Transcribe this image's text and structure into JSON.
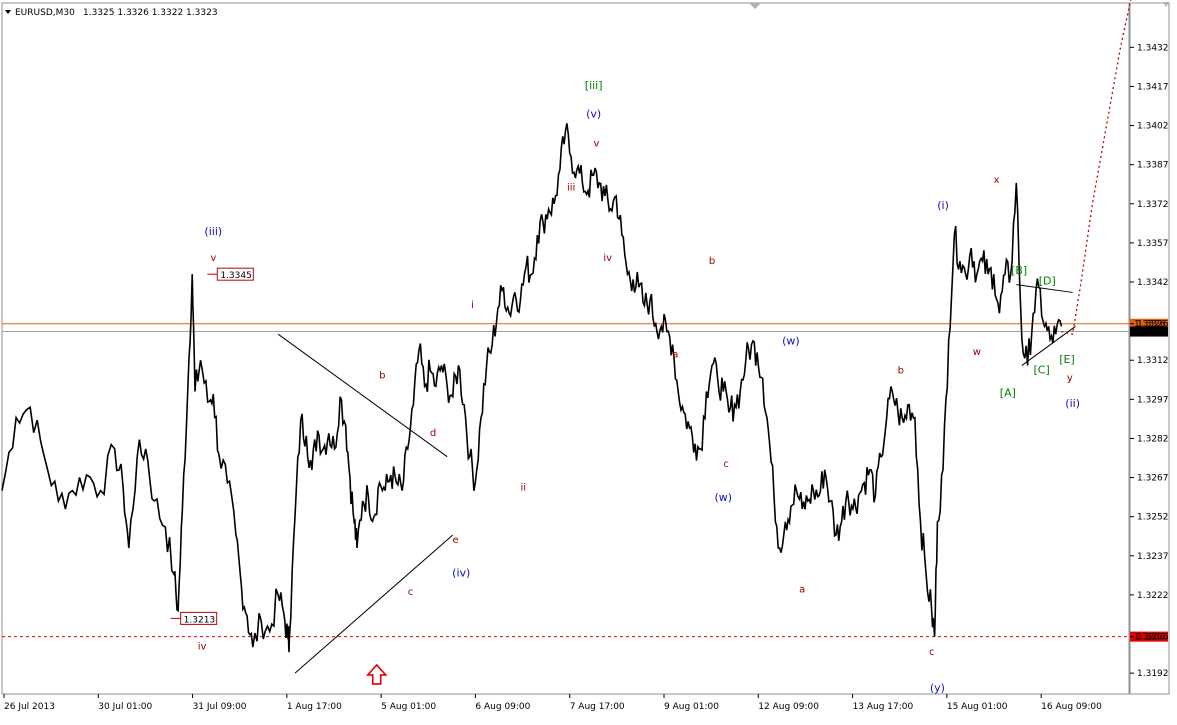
{
  "chart_data": {
    "type": "line",
    "symbol": "EURUSD,M30",
    "header_values": "1.3325 1.3326 1.3322 1.3323",
    "ylim": [
      1.3184,
      1.3449
    ],
    "yticks": [
      "1.3432",
      "1.3417",
      "1.3402",
      "1.3387",
      "1.3372",
      "1.3357",
      "1.3342",
      "1.3326",
      "1.3312",
      "1.3297",
      "1.3282",
      "1.3267",
      "1.3252",
      "1.3237",
      "1.3222",
      "1.3206",
      "1.3192"
    ],
    "current_price": "1.3323",
    "horizontal_lines": [
      {
        "value": 1.3326,
        "label": "1.3326",
        "color": "#e06010",
        "style": "solid"
      },
      {
        "value": 1.3323,
        "label": "1.3323",
        "color": "#a0a0a0",
        "style": "solid"
      },
      {
        "value": 1.3206,
        "label": "1.3206",
        "color": "#e00000",
        "style": "dotted"
      }
    ],
    "x_labels": [
      "26 Jul 2013",
      "30 Jul 01:00",
      "31 Jul 09:00",
      "1 Aug 17:00",
      "5 Aug 01:00",
      "6 Aug 09:00",
      "7 Aug 17:00",
      "9 Aug 01:00",
      "12 Aug 09:00",
      "13 Aug 17:00",
      "15 Aug 01:00",
      "16 Aug 09:00"
    ],
    "price_series": [
      [
        0,
        1.3262
      ],
      [
        0.5,
        1.329
      ],
      [
        1,
        1.3294
      ],
      [
        1.5,
        1.3275
      ],
      [
        2,
        1.3258
      ],
      [
        2.5,
        1.3262
      ],
      [
        3,
        1.3268
      ],
      [
        3.5,
        1.3262
      ],
      [
        4,
        1.3278
      ],
      [
        4.3,
        1.3263
      ],
      [
        4.5,
        1.324
      ],
      [
        4.8,
        1.3275
      ],
      [
        5.1,
        1.3278
      ],
      [
        5.4,
        1.3258
      ],
      [
        5.8,
        1.3248
      ],
      [
        6.1,
        1.323
      ],
      [
        6.25,
        1.3216
      ],
      [
        6.4,
        1.3254
      ],
      [
        6.6,
        1.3303
      ],
      [
        6.75,
        1.3345
      ],
      [
        6.85,
        1.33
      ],
      [
        7.05,
        1.3312
      ],
      [
        7.3,
        1.3296
      ],
      [
        7.5,
        1.3299
      ],
      [
        7.7,
        1.3276
      ],
      [
        8,
        1.3265
      ],
      [
        8.3,
        1.3245
      ],
      [
        8.5,
        1.3225
      ],
      [
        8.7,
        1.3214
      ],
      [
        8.9,
        1.3202
      ],
      [
        9.2,
        1.3212
      ],
      [
        9.5,
        1.3208
      ],
      [
        9.8,
        1.3222
      ],
      [
        10,
        1.3215
      ],
      [
        10.15,
        1.3205
      ],
      [
        10.2,
        1.3206
      ],
      [
        10.4,
        1.3252
      ],
      [
        10.6,
        1.3289
      ],
      [
        10.8,
        1.3283
      ],
      [
        11,
        1.327
      ],
      [
        11.2,
        1.3285
      ],
      [
        11.4,
        1.3278
      ],
      [
        11.6,
        1.3284
      ],
      [
        11.8,
        1.3278
      ],
      [
        12,
        1.3298
      ],
      [
        12.2,
        1.3287
      ],
      [
        12.35,
        1.3267
      ],
      [
        12.5,
        1.325
      ],
      [
        12.6,
        1.324
      ],
      [
        12.8,
        1.3258
      ],
      [
        13,
        1.326
      ],
      [
        13.2,
        1.3252
      ],
      [
        13.4,
        1.3265
      ],
      [
        13.6,
        1.3262
      ],
      [
        13.8,
        1.3268
      ],
      [
        14,
        1.3265
      ],
      [
        14.2,
        1.3262
      ],
      [
        14.4,
        1.3278
      ],
      [
        14.6,
        1.3295
      ],
      [
        14.8,
        1.3316
      ],
      [
        15,
        1.3302
      ],
      [
        15.2,
        1.3308
      ],
      [
        15.4,
        1.3302
      ],
      [
        15.6,
        1.331
      ],
      [
        15.8,
        1.3302
      ],
      [
        16,
        1.3298
      ],
      [
        16.2,
        1.331
      ],
      [
        16.4,
        1.3295
      ],
      [
        16.6,
        1.3275
      ],
      [
        16.8,
        1.3265
      ],
      [
        17,
        1.329
      ],
      [
        17.2,
        1.331
      ],
      [
        17.4,
        1.3318
      ],
      [
        17.6,
        1.3332
      ],
      [
        17.8,
        1.334
      ],
      [
        18,
        1.333
      ],
      [
        18.2,
        1.3338
      ],
      [
        18.4,
        1.3335
      ],
      [
        18.6,
        1.3348
      ],
      [
        18.8,
        1.3345
      ],
      [
        19,
        1.336
      ],
      [
        19.2,
        1.3365
      ],
      [
        19.4,
        1.337
      ],
      [
        19.6,
        1.3372
      ],
      [
        19.8,
        1.3385
      ],
      [
        20,
        1.34
      ],
      [
        20.2,
        1.339
      ],
      [
        20.4,
        1.3385
      ],
      [
        20.6,
        1.338
      ],
      [
        20.8,
        1.3377
      ],
      [
        21,
        1.3383
      ],
      [
        21.2,
        1.338
      ],
      [
        21.4,
        1.3375
      ],
      [
        21.6,
        1.337
      ],
      [
        21.8,
        1.3375
      ],
      [
        22,
        1.336
      ],
      [
        22.2,
        1.3345
      ],
      [
        22.4,
        1.3343
      ],
      [
        22.6,
        1.334
      ],
      [
        22.8,
        1.3333
      ],
      [
        23,
        1.3335
      ],
      [
        23.2,
        1.3326
      ],
      [
        23.4,
        1.3325
      ],
      [
        23.6,
        1.3323
      ],
      [
        23.8,
        1.3318
      ],
      [
        24,
        1.33
      ],
      [
        24.2,
        1.3292
      ],
      [
        24.4,
        1.3286
      ],
      [
        24.6,
        1.328
      ],
      [
        24.8,
        1.3278
      ],
      [
        25,
        1.33
      ],
      [
        25.2,
        1.331
      ],
      [
        25.4,
        1.3305
      ],
      [
        25.6,
        1.33
      ],
      [
        25.8,
        1.3292
      ],
      [
        26,
        1.3295
      ],
      [
        26.2,
        1.33
      ],
      [
        26.4,
        1.3312
      ],
      [
        26.6,
        1.3318
      ],
      [
        26.8,
        1.3315
      ],
      [
        27,
        1.3305
      ],
      [
        27.2,
        1.3285
      ],
      [
        27.4,
        1.326
      ],
      [
        27.6,
        1.324
      ],
      [
        27.8,
        1.325
      ],
      [
        28,
        1.3256
      ],
      [
        28.2,
        1.3262
      ],
      [
        28.4,
        1.3255
      ],
      [
        28.6,
        1.3258
      ],
      [
        28.8,
        1.3262
      ],
      [
        29,
        1.326
      ],
      [
        29.2,
        1.327
      ],
      [
        29.4,
        1.3258
      ],
      [
        29.6,
        1.3245
      ],
      [
        29.8,
        1.325
      ],
      [
        30,
        1.3262
      ],
      [
        30.2,
        1.3255
      ],
      [
        30.4,
        1.326
      ],
      [
        30.6,
        1.3265
      ],
      [
        30.8,
        1.327
      ],
      [
        31,
        1.326
      ],
      [
        31.2,
        1.3275
      ],
      [
        31.4,
        1.329
      ],
      [
        31.6,
        1.33
      ],
      [
        31.8,
        1.3292
      ],
      [
        32,
        1.3288
      ],
      [
        32.2,
        1.3295
      ],
      [
        32.4,
        1.329
      ],
      [
        32.6,
        1.325
      ],
      [
        32.8,
        1.323
      ],
      [
        33,
        1.3215
      ],
      [
        33.1,
        1.3206
      ],
      [
        33.2,
        1.325
      ],
      [
        33.4,
        1.327
      ],
      [
        33.6,
        1.332
      ],
      [
        33.8,
        1.336
      ],
      [
        34,
        1.335
      ],
      [
        34.2,
        1.3345
      ],
      [
        34.4,
        1.3355
      ],
      [
        34.6,
        1.3345
      ],
      [
        34.8,
        1.335
      ],
      [
        35,
        1.3345
      ],
      [
        35.2,
        1.3345
      ],
      [
        35.4,
        1.333
      ],
      [
        35.6,
        1.3345
      ],
      [
        35.8,
        1.3345
      ],
      [
        36,
        1.338
      ],
      [
        36.2,
        1.332
      ],
      [
        36.4,
        1.331
      ],
      [
        36.6,
        1.333
      ],
      [
        36.8,
        1.334
      ],
      [
        37,
        1.3325
      ],
      [
        37.2,
        1.332
      ],
      [
        37.4,
        1.3322
      ],
      [
        37.6,
        1.3325
      ]
    ],
    "projection": [
      [
        37.6,
        1.3323
      ],
      [
        38.0,
        1.3322
      ],
      [
        38.3,
        1.3342
      ],
      [
        38.7,
        1.3372
      ],
      [
        39.2,
        1.3402
      ],
      [
        39.7,
        1.3432
      ],
      [
        40.1,
        1.3452
      ]
    ],
    "triangle_lines": [
      {
        "from": [
          9.8,
          1.3322
        ],
        "to": [
          15.8,
          1.3275
        ]
      },
      {
        "from": [
          10.4,
          1.3192
        ],
        "to": [
          16.0,
          1.3245
        ]
      },
      {
        "from": [
          36.0,
          1.3341
        ],
        "to": [
          38.0,
          1.3338
        ]
      },
      {
        "from": [
          36.2,
          1.331
        ],
        "to": [
          38.1,
          1.3325
        ]
      }
    ],
    "price_tags": [
      {
        "text": "1.3345",
        "x": 7.5,
        "y": 1.3345
      },
      {
        "text": "1.3213",
        "x": 6.2,
        "y": 1.3213
      }
    ],
    "wave_labels": [
      {
        "text": "[iii]",
        "x": 21.0,
        "y": 1.3416,
        "color": "#008000"
      },
      {
        "text": "(v)",
        "x": 21.0,
        "y": 1.3405,
        "color": "#1010c0"
      },
      {
        "text": "v",
        "x": 21.1,
        "y": 1.3394,
        "color": "#a00000"
      },
      {
        "text": "iii",
        "x": 20.2,
        "y": 1.3377,
        "color": "#a00000"
      },
      {
        "text": "iv",
        "x": 21.5,
        "y": 1.335,
        "color": "#a00000"
      },
      {
        "text": "i",
        "x": 16.7,
        "y": 1.3332,
        "color": "#a00000"
      },
      {
        "text": "ii",
        "x": 18.5,
        "y": 1.3262,
        "color": "#a00000"
      },
      {
        "text": "(iii)",
        "x": 7.5,
        "y": 1.336,
        "color": "#1010c0"
      },
      {
        "text": "v",
        "x": 7.5,
        "y": 1.335,
        "color": "#a00000"
      },
      {
        "text": "iv",
        "x": 7.1,
        "y": 1.3201,
        "color": "#a00000"
      },
      {
        "text": "b",
        "x": 13.5,
        "y": 1.3305,
        "color": "#a00000"
      },
      {
        "text": "d",
        "x": 15.3,
        "y": 1.3283,
        "color": "#a00000"
      },
      {
        "text": "e",
        "x": 16.1,
        "y": 1.3242,
        "color": "#a00000"
      },
      {
        "text": "c",
        "x": 14.5,
        "y": 1.3222,
        "color": "#a00000"
      },
      {
        "text": "(iv)",
        "x": 16.3,
        "y": 1.3229,
        "color": "#1010c0"
      },
      {
        "text": "b",
        "x": 25.2,
        "y": 1.3349,
        "color": "#a00000"
      },
      {
        "text": "a",
        "x": 23.9,
        "y": 1.3313,
        "color": "#a00000"
      },
      {
        "text": "c",
        "x": 25.7,
        "y": 1.3271,
        "color": "#a00000"
      },
      {
        "text": "(w)",
        "x": 25.6,
        "y": 1.3258,
        "color": "#1010c0"
      },
      {
        "text": "(w)",
        "x": 28.0,
        "y": 1.3318,
        "color": "#1010c0"
      },
      {
        "text": "a",
        "x": 28.4,
        "y": 1.3223,
        "color": "#a00000"
      },
      {
        "text": "b",
        "x": 31.9,
        "y": 1.3307,
        "color": "#a00000"
      },
      {
        "text": "c",
        "x": 33.0,
        "y": 1.3199,
        "color": "#a00000"
      },
      {
        "text": "(y)",
        "x": 33.2,
        "y": 1.3185,
        "color": "#1010c0"
      },
      {
        "text": "(i)",
        "x": 33.4,
        "y": 1.337,
        "color": "#1010c0"
      },
      {
        "text": "x",
        "x": 35.3,
        "y": 1.338,
        "color": "#a00000"
      },
      {
        "text": "w",
        "x": 34.6,
        "y": 1.3314,
        "color": "#a00000"
      },
      {
        "text": "[B]",
        "x": 36.1,
        "y": 1.3345,
        "color": "#008000"
      },
      {
        "text": "[D]",
        "x": 37.1,
        "y": 1.3341,
        "color": "#008000"
      },
      {
        "text": "[C]",
        "x": 36.9,
        "y": 1.3307,
        "color": "#008000"
      },
      {
        "text": "[E]",
        "x": 37.8,
        "y": 1.3311,
        "color": "#008000"
      },
      {
        "text": "[A]",
        "x": 35.7,
        "y": 1.3298,
        "color": "#008000"
      },
      {
        "text": "y",
        "x": 37.9,
        "y": 1.3304,
        "color": "#a00000"
      },
      {
        "text": "(ii)",
        "x": 38.0,
        "y": 1.3294,
        "color": "#1010c0"
      }
    ],
    "arrow": {
      "x": 13.3,
      "y": 1.3189,
      "color": "#e00000",
      "icon": "up-arrow-icon"
    },
    "colors": {
      "price": "#000000",
      "projection": "#c00000",
      "grid": "#ffffff",
      "background": "#ffffff"
    },
    "grid": false
  }
}
